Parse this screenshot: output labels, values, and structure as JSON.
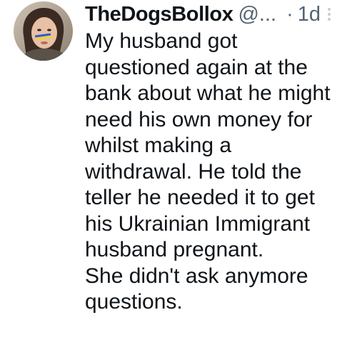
{
  "author": {
    "display_name": "TheDogsBollox",
    "handle": "@...",
    "separator": "·",
    "timestamp": "1d",
    "avatar_icon": "user-avatar-photo"
  },
  "more_icon": "more-options-icon",
  "tweet": {
    "lines": [
      "My husband got",
      "questioned again at the",
      "bank about what he might",
      "need his own money for",
      "whilst making a",
      "withdrawal. He told the",
      "teller he needed it to get",
      "his Ukrainian Immigrant",
      "husband pregnant.",
      "She didn't ask anymore",
      "questions."
    ]
  },
  "colors": {
    "text_primary": "#0f1419",
    "text_secondary": "#536471",
    "background": "#ffffff"
  }
}
